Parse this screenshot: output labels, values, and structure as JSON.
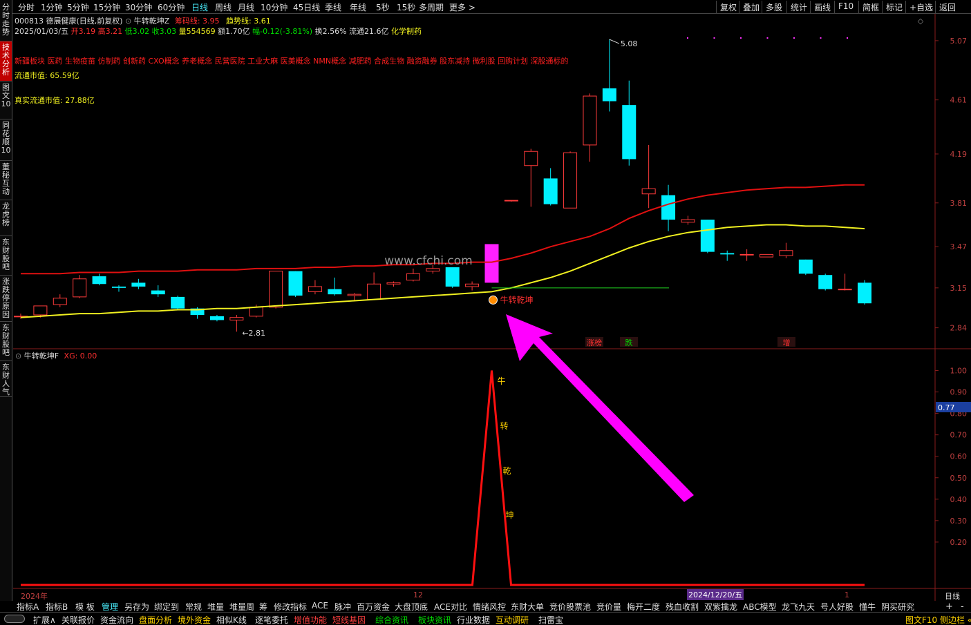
{
  "left_tabs": [
    {
      "label": "分时走势",
      "active": false
    },
    {
      "label": "技术分析",
      "active": true
    },
    {
      "label": "图文10",
      "active": false
    },
    {
      "label": "同花顺10",
      "active": false
    },
    {
      "label": "董秘互动",
      "active": false
    },
    {
      "label": "龙虎榜",
      "active": false
    },
    {
      "label": "东财股吧",
      "active": false
    },
    {
      "label": "涨跌停原因",
      "active": false
    },
    {
      "label": "东财股吧",
      "active": false
    },
    {
      "label": "东财人气",
      "active": false
    }
  ],
  "period_tabs": [
    "分时",
    "1分钟",
    "5分钟",
    "15分钟",
    "30分钟",
    "60分钟",
    "日线",
    "周线",
    "月线",
    "10分钟",
    "45日线",
    "季线",
    "年线",
    "5秒",
    "15秒",
    "多周期",
    "更多 >"
  ],
  "active_period": "日线",
  "right_buttons": [
    "复权",
    "叠加",
    "多股",
    "统计",
    "画线",
    "F10",
    "简框",
    "标记",
    "+自选",
    "返回"
  ],
  "stock": {
    "code_name": "000813 德展健康(日线,前复权)",
    "indicator": "牛转乾坤Z",
    "chip_line": "筹码线: 3.95",
    "trend_line": "趋势线: 3.61",
    "date": "2025/01/03/五",
    "open": "开3.19",
    "high": "高3.21",
    "low": "低3.02",
    "close": "收3.03",
    "volume": "量554569",
    "amount": "额1.70亿",
    "change": "幅-0.12(-3.81%)",
    "turnover": "换2.56%",
    "float_shares": "流通21.6亿",
    "industry": "化学制药"
  },
  "concepts": "新疆板块 医药 生物疫苗 仿制药 创新药 CXO概念 养老概念 民营医院 工业大麻 医美概念 NMN概念 减肥药 合成生物 融资融券 股东减持 微利股 回购计划 深股通标的",
  "float_mv": "流通市值: 65.59亿",
  "true_float_mv": "真实流通市值: 27.88亿",
  "watermark": "www.cfchi.com",
  "signal_label": "牛转乾坤",
  "markers": {
    "high_label": "5.08",
    "low_label": "2.81"
  },
  "event_tags": [
    "涨榜",
    "跌",
    "增"
  ],
  "sub_panel": {
    "title": "牛转乾坤F",
    "xg": "XG: 0.00",
    "value_box": "0.77",
    "peak_chars": [
      "牛",
      "转",
      "乾",
      "坤"
    ]
  },
  "date_axis": {
    "left": "2024年",
    "mid": "12",
    "cursor": "2024/12/20/五",
    "right": "1",
    "period": "日线"
  },
  "indicator_tabs": [
    "指标A",
    "指标B",
    "模 板",
    "管理",
    "另存为",
    "绑定到",
    "常规",
    "堆量",
    "堆量周",
    "筹",
    "修改指标",
    "ACE",
    "脉冲",
    "百万资金",
    "大盘顶底",
    "ACE对比",
    "情绪风控",
    "东财大单",
    "竞价股票池",
    "竞价量",
    "梅开二度",
    "残血收割",
    "双紫擒龙",
    "ABC模型",
    "龙飞九天",
    "号人好股",
    "懂牛",
    "阴买研究"
  ],
  "active_indicator": "管理",
  "bottom_tabs": [
    {
      "label": "扩展∧",
      "style": "normal"
    },
    {
      "label": "关联报价",
      "style": "normal"
    },
    {
      "label": "资金流向",
      "style": "normal"
    },
    {
      "label": "盘面分析",
      "style": "yellow"
    },
    {
      "label": "境外资金",
      "style": "yellow"
    },
    {
      "label": "相似K线",
      "style": "normal"
    },
    {
      "label": "逐笔委托",
      "style": "normal"
    },
    {
      "label": "增值功能",
      "style": "red"
    },
    {
      "label": "短线基因",
      "style": "red"
    },
    {
      "label": "综合资讯",
      "style": "green"
    },
    {
      "label": "板块资讯",
      "style": "green"
    },
    {
      "label": "行业数据",
      "style": "normal"
    },
    {
      "label": "互动调研",
      "style": "yellow"
    },
    {
      "label": "扫雷宝",
      "style": "normal"
    }
  ],
  "bottom_right": "图文F10 侧边栏 «",
  "colors": {
    "up": "#ff3b3b",
    "down": "#00f0ff",
    "ma_red": "#e01010",
    "ma_yellow": "#f0f020",
    "arrow": "#ff00ff",
    "signal": "#ff20ff"
  },
  "chart_data": {
    "type": "candlestick",
    "title": "000813 德展健康(日线,前复权)",
    "ylabel": "",
    "ylim": [
      2.72,
      5.15
    ],
    "y_ticks": [
      5.07,
      4.61,
      4.19,
      3.81,
      3.47,
      3.15,
      2.84
    ],
    "candles": [
      {
        "o": 2.93,
        "h": 2.95,
        "l": 2.91,
        "c": 2.93
      },
      {
        "o": 2.94,
        "h": 3.01,
        "l": 2.92,
        "c": 3.01
      },
      {
        "o": 3.02,
        "h": 3.1,
        "l": 3.0,
        "c": 3.07
      },
      {
        "o": 3.08,
        "h": 3.25,
        "l": 3.07,
        "c": 3.22
      },
      {
        "o": 3.24,
        "h": 3.26,
        "l": 3.17,
        "c": 3.18
      },
      {
        "o": 3.16,
        "h": 3.17,
        "l": 3.12,
        "c": 3.15
      },
      {
        "o": 3.19,
        "h": 3.22,
        "l": 3.14,
        "c": 3.16
      },
      {
        "o": 3.13,
        "h": 3.17,
        "l": 3.08,
        "c": 3.1
      },
      {
        "o": 3.08,
        "h": 3.09,
        "l": 2.98,
        "c": 2.99
      },
      {
        "o": 2.99,
        "h": 3.0,
        "l": 2.91,
        "c": 2.94
      },
      {
        "o": 2.93,
        "h": 2.94,
        "l": 2.89,
        "c": 2.9
      },
      {
        "o": 2.9,
        "h": 2.94,
        "l": 2.81,
        "c": 2.92
      },
      {
        "o": 2.93,
        "h": 3.02,
        "l": 2.92,
        "c": 3.0
      },
      {
        "o": 3.0,
        "h": 3.28,
        "l": 2.99,
        "c": 3.28
      },
      {
        "o": 3.28,
        "h": 3.28,
        "l": 3.08,
        "c": 3.09
      },
      {
        "o": 3.12,
        "h": 3.21,
        "l": 3.1,
        "c": 3.16
      },
      {
        "o": 3.14,
        "h": 3.23,
        "l": 3.09,
        "c": 3.1
      },
      {
        "o": 3.09,
        "h": 3.11,
        "l": 3.05,
        "c": 3.1
      },
      {
        "o": 3.06,
        "h": 3.27,
        "l": 3.06,
        "c": 3.18
      },
      {
        "o": 3.18,
        "h": 3.2,
        "l": 3.16,
        "c": 3.19
      },
      {
        "o": 3.21,
        "h": 3.3,
        "l": 3.2,
        "c": 3.26
      },
      {
        "o": 3.28,
        "h": 3.33,
        "l": 3.26,
        "c": 3.3
      },
      {
        "o": 3.31,
        "h": 3.31,
        "l": 3.15,
        "c": 3.16
      },
      {
        "o": 3.16,
        "h": 3.2,
        "l": 3.13,
        "c": 3.18
      },
      {
        "o": 3.19,
        "h": 3.49,
        "l": 3.19,
        "c": 3.49
      },
      {
        "o": 3.83,
        "h": 3.83,
        "l": 3.82,
        "c": 3.83
      },
      {
        "o": 4.1,
        "h": 4.23,
        "l": 3.78,
        "c": 4.21
      },
      {
        "o": 4.0,
        "h": 4.08,
        "l": 3.79,
        "c": 3.8
      },
      {
        "o": 3.77,
        "h": 4.21,
        "l": 3.77,
        "c": 4.2
      },
      {
        "o": 4.26,
        "h": 4.66,
        "l": 4.13,
        "c": 4.64
      },
      {
        "o": 4.7,
        "h": 5.08,
        "l": 4.52,
        "c": 4.6
      },
      {
        "o": 4.57,
        "h": 4.76,
        "l": 4.1,
        "c": 4.15
      },
      {
        "o": 3.88,
        "h": 4.26,
        "l": 3.77,
        "c": 3.92
      },
      {
        "o": 3.87,
        "h": 3.95,
        "l": 3.59,
        "c": 3.68
      },
      {
        "o": 3.66,
        "h": 3.71,
        "l": 3.64,
        "c": 3.68
      },
      {
        "o": 3.68,
        "h": 3.68,
        "l": 3.42,
        "c": 3.43
      },
      {
        "o": 3.42,
        "h": 3.44,
        "l": 3.36,
        "c": 3.41
      },
      {
        "o": 3.41,
        "h": 3.45,
        "l": 3.36,
        "c": 3.41
      },
      {
        "o": 3.39,
        "h": 3.41,
        "l": 3.39,
        "c": 3.41
      },
      {
        "o": 3.4,
        "h": 3.5,
        "l": 3.38,
        "c": 3.44
      },
      {
        "o": 3.37,
        "h": 3.37,
        "l": 3.25,
        "c": 3.26
      },
      {
        "o": 3.25,
        "h": 3.26,
        "l": 3.13,
        "c": 3.14
      },
      {
        "o": 3.14,
        "h": 3.26,
        "l": 3.13,
        "c": 3.14
      },
      {
        "o": 3.19,
        "h": 3.21,
        "l": 3.02,
        "c": 3.03
      }
    ],
    "series": [
      {
        "name": "筹码线",
        "values": [
          3.26,
          3.26,
          3.26,
          3.27,
          3.27,
          3.27,
          3.28,
          3.28,
          3.28,
          3.29,
          3.29,
          3.29,
          3.3,
          3.3,
          3.3,
          3.31,
          3.31,
          3.32,
          3.32,
          3.33,
          3.33,
          3.34,
          3.34,
          3.35,
          3.35,
          3.38,
          3.42,
          3.47,
          3.51,
          3.55,
          3.61,
          3.69,
          3.75,
          3.8,
          3.84,
          3.87,
          3.89,
          3.91,
          3.92,
          3.93,
          3.93,
          3.94,
          3.95,
          3.95
        ]
      },
      {
        "name": "趋势线",
        "values": [
          2.92,
          2.93,
          2.94,
          2.95,
          2.95,
          2.96,
          2.97,
          2.97,
          2.98,
          2.98,
          2.99,
          2.99,
          3.0,
          3.01,
          3.02,
          3.03,
          3.04,
          3.05,
          3.06,
          3.07,
          3.08,
          3.09,
          3.1,
          3.11,
          3.12,
          3.15,
          3.19,
          3.23,
          3.28,
          3.34,
          3.4,
          3.46,
          3.51,
          3.55,
          3.58,
          3.6,
          3.62,
          3.63,
          3.64,
          3.64,
          3.63,
          3.63,
          3.62,
          3.61
        ]
      }
    ],
    "signal_bar_index": 24,
    "sub_series": {
      "name": "XG",
      "ylim": [
        0,
        1.05
      ],
      "y_ticks": [
        1.0,
        0.9,
        0.8,
        0.7,
        0.6,
        0.5,
        0.4,
        0.3,
        0.2
      ],
      "peak_index": 24,
      "peak_value": 1.0
    }
  }
}
